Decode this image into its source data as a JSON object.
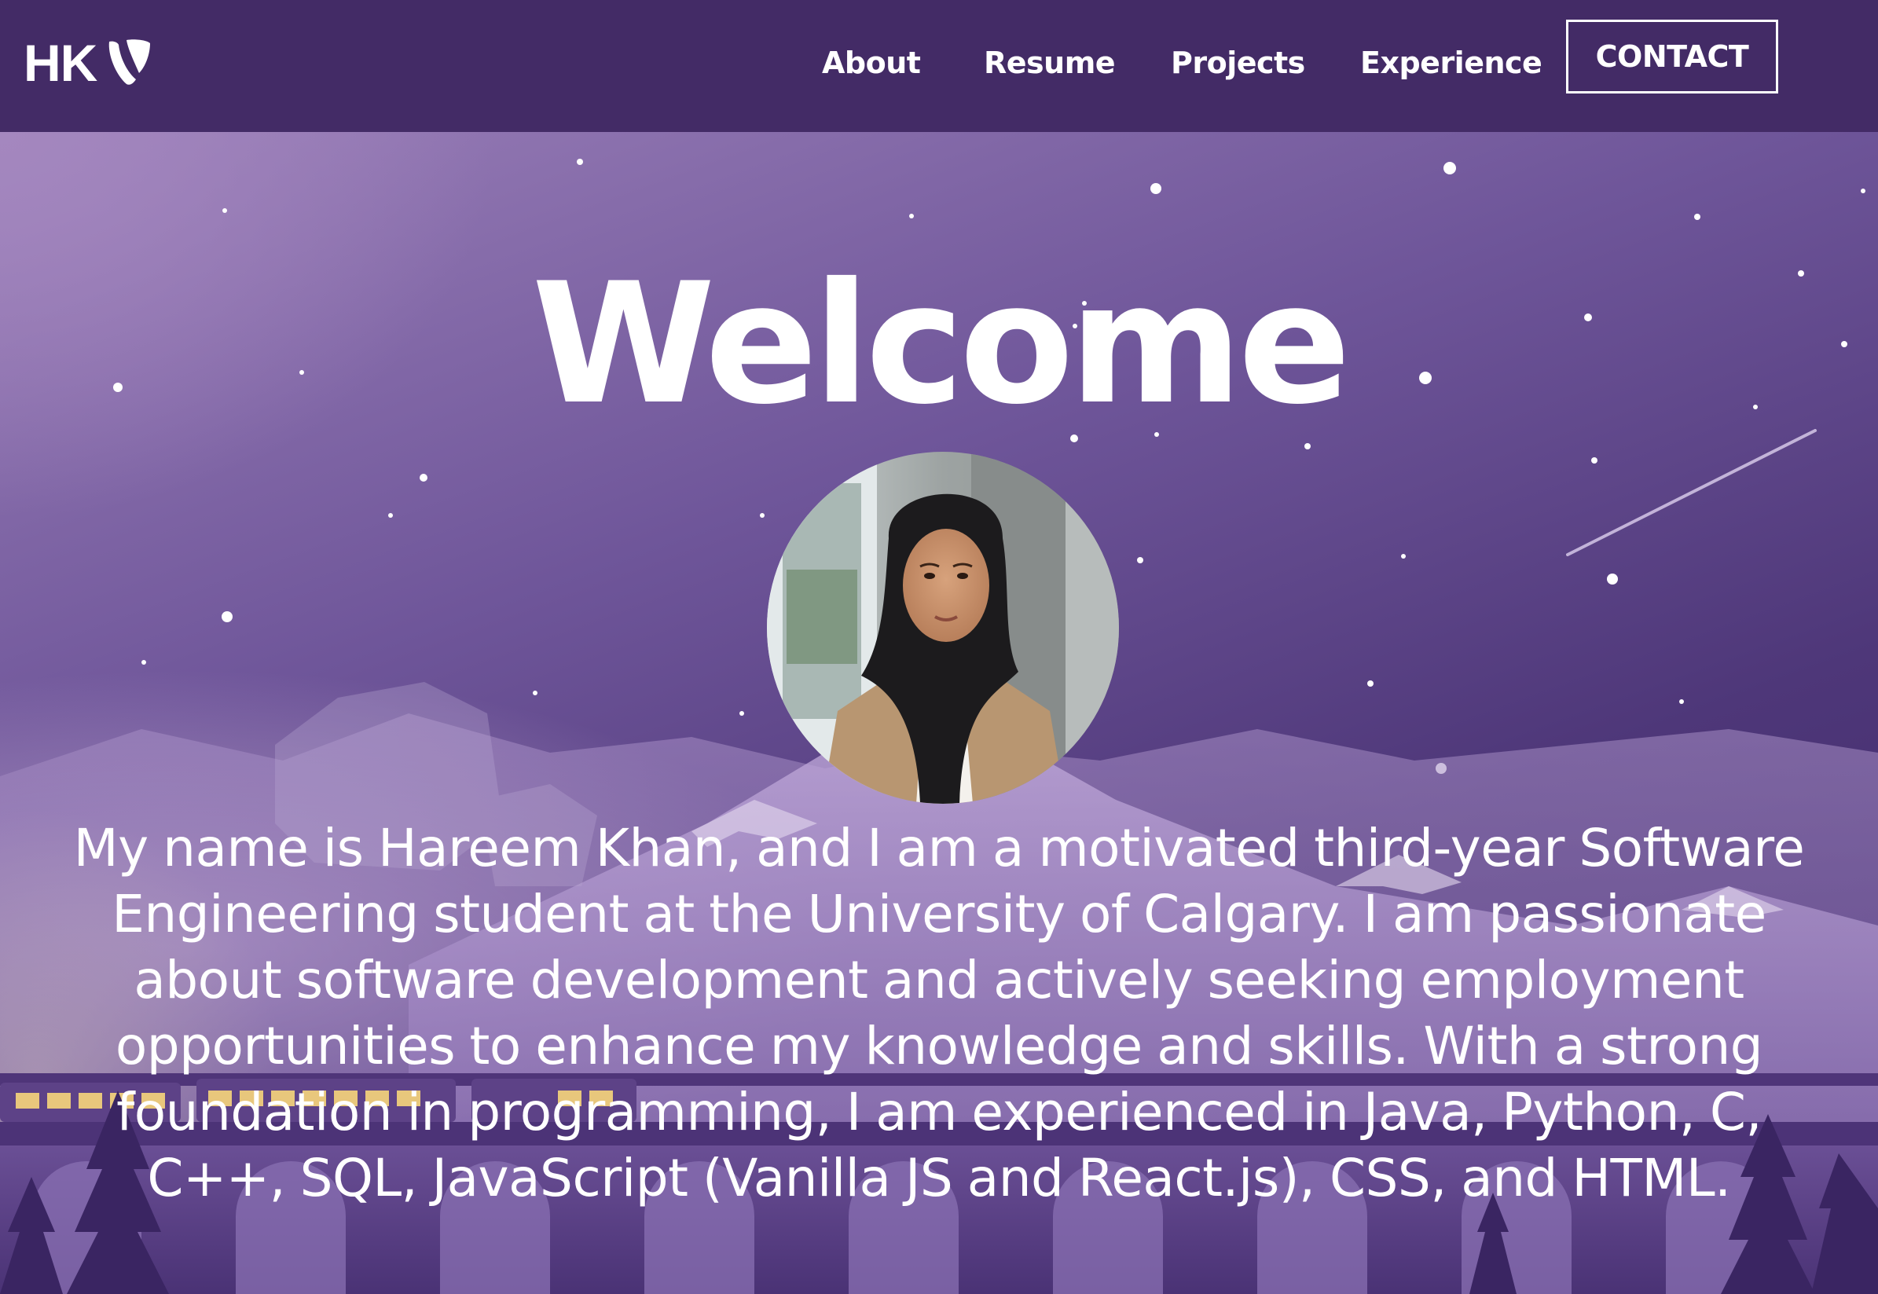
{
  "brand": {
    "logo_text": "HK",
    "logo_mark": "typo3-icon"
  },
  "nav": {
    "items": [
      {
        "label": "About"
      },
      {
        "label": "Resume"
      },
      {
        "label": "Projects"
      },
      {
        "label": "Experience"
      }
    ],
    "contact_label": "CONTACT"
  },
  "hero": {
    "title": "Welcome",
    "avatar_alt": "profile-photo",
    "intro": "My name is Hareem Khan, and I am a motivated third-year Software Engineering student at the University of Calgary. I am passionate about software development and actively seeking employment opportunities to enhance my knowledge and skills. With a strong foundation in programming, I am experienced in Java, Python, C, C++, SQL, JavaScript (Vanilla JS and React.js), CSS, and HTML."
  },
  "colors": {
    "navbar": "#432b66",
    "hero_top": "#9a7fb8",
    "hero_bottom": "#3b2566",
    "text": "#ffffff"
  }
}
